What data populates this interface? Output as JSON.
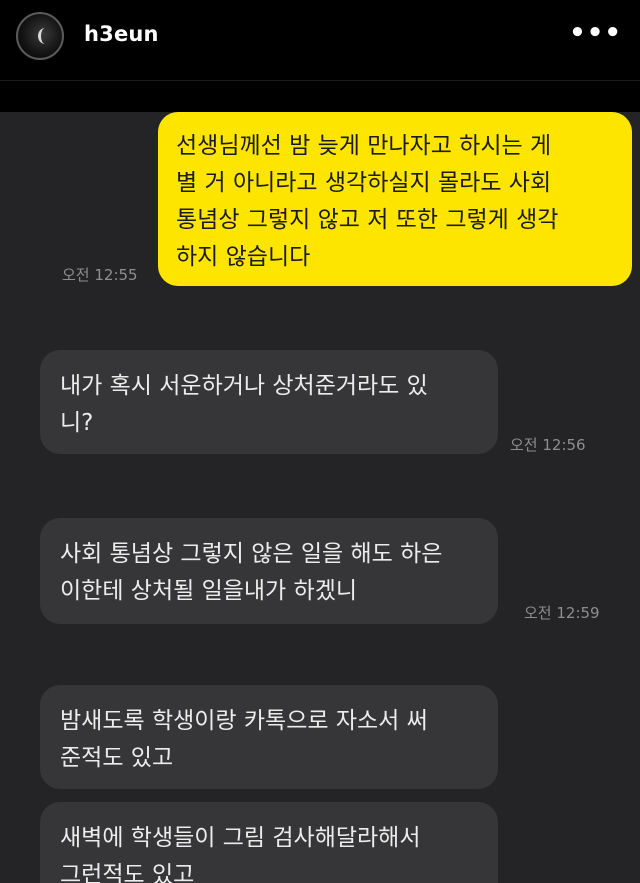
{
  "header": {
    "username": "h3eun",
    "more_label": "•••"
  },
  "messages": [
    {
      "side": "out",
      "text": "선생님께선 밤 늦게 만나자고 하시는 게\n별 거 아니라고 생각하실지 몰라도 사회\n통념상 그렇지 않고 저 또한 그렇게 생각\n하지 않습니다",
      "time": "오전 12:55"
    },
    {
      "side": "in",
      "text": "내가 혹시 서운하거나 상처준거라도 있\n니?",
      "time": "오전 12:56"
    },
    {
      "side": "in",
      "text": "사회 통념상 그렇지 않은 일을 해도 하은\n이한테 상처될 일을내가 하겠니",
      "time": "오전 12:59"
    },
    {
      "side": "in",
      "text": "밤새도록 학생이랑 카톡으로 자소서 써\n준적도 있고",
      "time": ""
    },
    {
      "side": "in",
      "text": "새벽에 학생들이 그림 검사해달라해서\n그런적도 있고",
      "time": ""
    }
  ],
  "colors": {
    "outgoing_bubble": "#fee500",
    "incoming_bubble": "#363638",
    "chat_background": "#242426"
  }
}
